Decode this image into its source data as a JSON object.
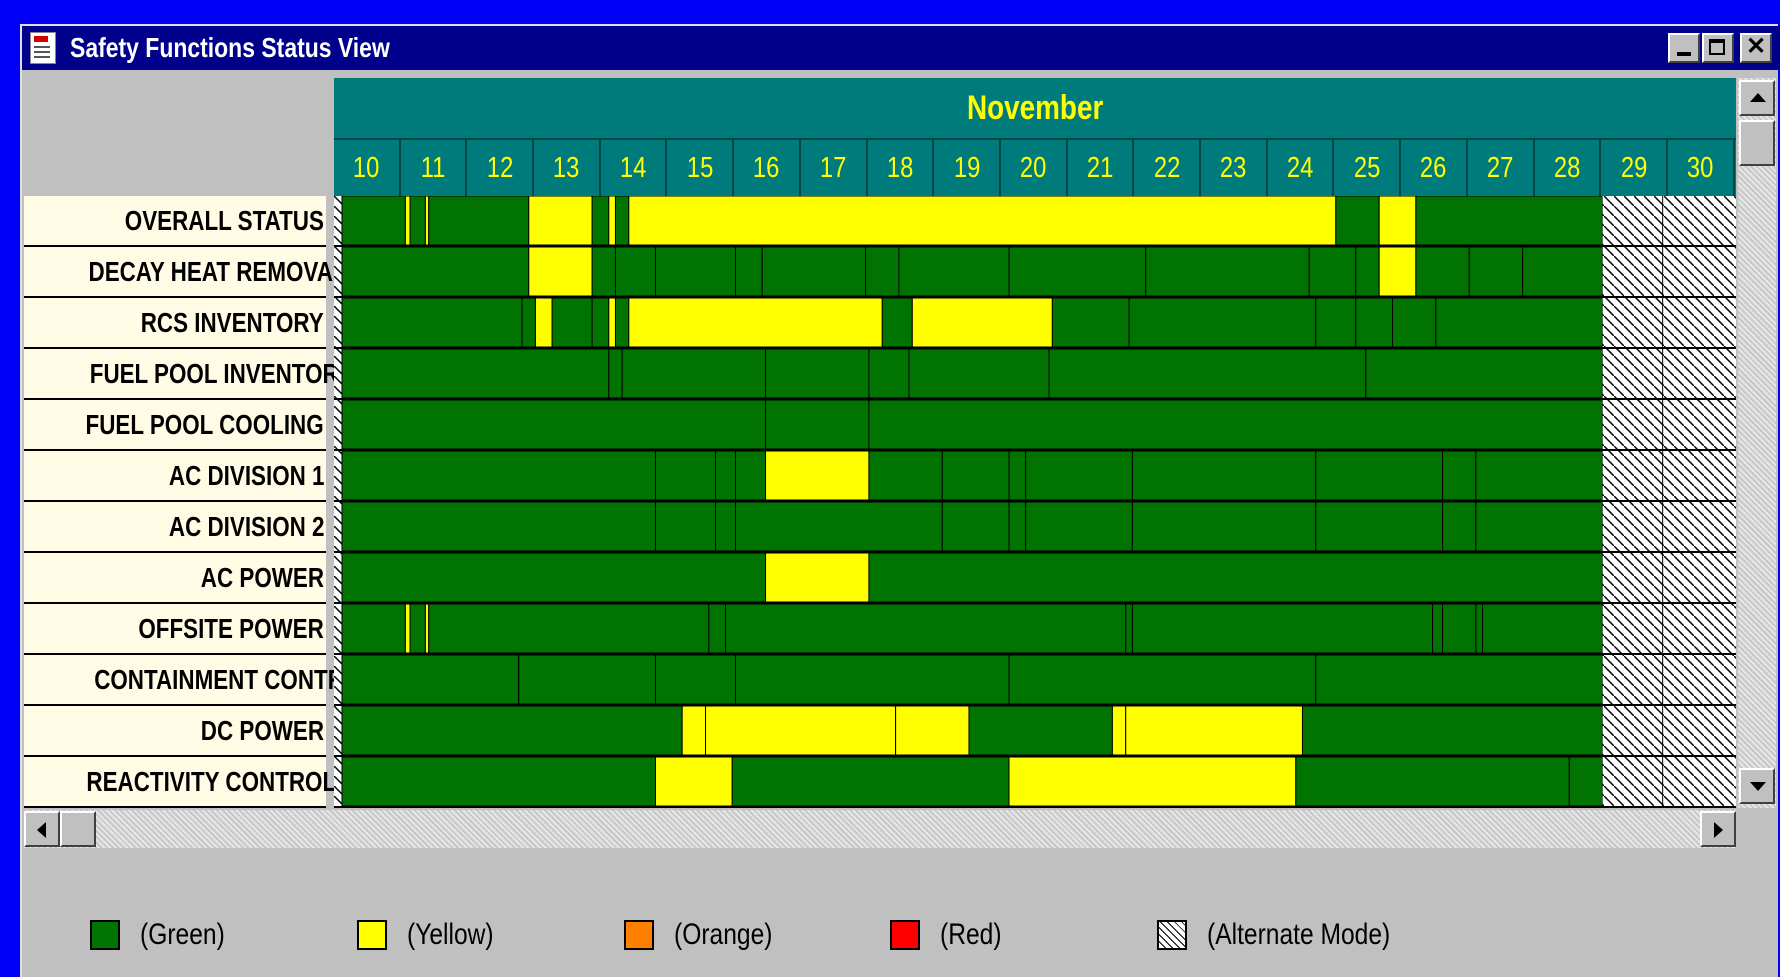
{
  "window": {
    "title": "Safety Functions Status View",
    "buttons": [
      "minimize",
      "maximize",
      "close"
    ]
  },
  "colors": {
    "desktop": "#0000f6",
    "titlebar": "#00008a",
    "header": "#007b7b",
    "header_text": "#ffff00",
    "green": "#007300",
    "yellow": "#ffff00",
    "orange": "#ff8000",
    "red": "#ff0000",
    "label_bg": "#fffbe5"
  },
  "timeline": {
    "month": "November",
    "days": [
      "10",
      "11",
      "12",
      "13",
      "14",
      "15",
      "16",
      "17",
      "18",
      "19",
      "20",
      "21",
      "22",
      "23",
      "24",
      "25",
      "26",
      "27",
      "28",
      "29",
      "30"
    ],
    "alternate_mode_from_day": 28.9,
    "day_range": [
      10,
      31
    ]
  },
  "rows": [
    {
      "label": "OVERALL STATUS",
      "segments": [
        {
          "s": 10.0,
          "e": 10.95,
          "c": "green"
        },
        {
          "s": 10.95,
          "e": 11.02,
          "c": "yellow"
        },
        {
          "s": 11.02,
          "e": 11.25,
          "c": "green"
        },
        {
          "s": 11.25,
          "e": 11.3,
          "c": "yellow"
        },
        {
          "s": 11.3,
          "e": 12.8,
          "c": "green"
        },
        {
          "s": 12.8,
          "e": 13.75,
          "c": "yellow"
        },
        {
          "s": 13.75,
          "e": 14.0,
          "c": "green"
        },
        {
          "s": 14.0,
          "e": 14.1,
          "c": "yellow"
        },
        {
          "s": 14.1,
          "e": 14.3,
          "c": "green"
        },
        {
          "s": 14.3,
          "e": 24.9,
          "c": "yellow"
        },
        {
          "s": 24.9,
          "e": 25.55,
          "c": "green"
        },
        {
          "s": 25.55,
          "e": 26.1,
          "c": "yellow"
        },
        {
          "s": 26.1,
          "e": 28.9,
          "c": "green"
        }
      ]
    },
    {
      "label": "DECAY HEAT REMOVAL",
      "segments": [
        {
          "s": 10.0,
          "e": 12.8,
          "c": "green"
        },
        {
          "s": 12.8,
          "e": 13.75,
          "c": "yellow"
        },
        {
          "s": 13.75,
          "e": 14.1,
          "c": "green"
        },
        {
          "s": 14.1,
          "e": 14.7,
          "c": "green"
        },
        {
          "s": 14.7,
          "e": 15.9,
          "c": "green"
        },
        {
          "s": 15.9,
          "e": 16.3,
          "c": "green"
        },
        {
          "s": 16.3,
          "e": 17.85,
          "c": "green"
        },
        {
          "s": 17.85,
          "e": 18.35,
          "c": "green"
        },
        {
          "s": 18.35,
          "e": 20.0,
          "c": "green"
        },
        {
          "s": 20.0,
          "e": 22.05,
          "c": "green"
        },
        {
          "s": 22.05,
          "e": 24.5,
          "c": "green"
        },
        {
          "s": 24.5,
          "e": 25.2,
          "c": "green"
        },
        {
          "s": 25.2,
          "e": 25.55,
          "c": "green"
        },
        {
          "s": 25.55,
          "e": 26.1,
          "c": "yellow"
        },
        {
          "s": 26.1,
          "e": 26.9,
          "c": "green"
        },
        {
          "s": 26.9,
          "e": 27.7,
          "c": "green"
        },
        {
          "s": 27.7,
          "e": 28.9,
          "c": "green"
        }
      ]
    },
    {
      "label": "RCS INVENTORY",
      "segments": [
        {
          "s": 10.0,
          "e": 12.7,
          "c": "green"
        },
        {
          "s": 12.7,
          "e": 12.9,
          "c": "green"
        },
        {
          "s": 12.9,
          "e": 13.15,
          "c": "yellow"
        },
        {
          "s": 13.15,
          "e": 13.75,
          "c": "green"
        },
        {
          "s": 13.75,
          "e": 14.0,
          "c": "green"
        },
        {
          "s": 14.0,
          "e": 14.1,
          "c": "yellow"
        },
        {
          "s": 14.1,
          "e": 14.3,
          "c": "green"
        },
        {
          "s": 14.3,
          "e": 18.1,
          "c": "yellow"
        },
        {
          "s": 18.1,
          "e": 18.55,
          "c": "green"
        },
        {
          "s": 18.55,
          "e": 20.65,
          "c": "yellow"
        },
        {
          "s": 20.65,
          "e": 21.8,
          "c": "green"
        },
        {
          "s": 21.8,
          "e": 24.6,
          "c": "green"
        },
        {
          "s": 24.6,
          "e": 25.2,
          "c": "green"
        },
        {
          "s": 25.2,
          "e": 25.75,
          "c": "green"
        },
        {
          "s": 25.75,
          "e": 26.4,
          "c": "green"
        },
        {
          "s": 26.4,
          "e": 28.9,
          "c": "green"
        }
      ]
    },
    {
      "label": "FUEL POOL INVENTORY",
      "segments": [
        {
          "s": 10.0,
          "e": 14.0,
          "c": "green"
        },
        {
          "s": 14.0,
          "e": 14.2,
          "c": "green"
        },
        {
          "s": 14.2,
          "e": 16.35,
          "c": "green"
        },
        {
          "s": 16.35,
          "e": 17.9,
          "c": "green"
        },
        {
          "s": 17.9,
          "e": 18.5,
          "c": "green"
        },
        {
          "s": 18.5,
          "e": 20.6,
          "c": "green"
        },
        {
          "s": 20.6,
          "e": 25.35,
          "c": "green"
        },
        {
          "s": 25.35,
          "e": 28.9,
          "c": "green"
        }
      ]
    },
    {
      "label": "FUEL POOL COOLING",
      "segments": [
        {
          "s": 10.0,
          "e": 16.35,
          "c": "green"
        },
        {
          "s": 16.35,
          "e": 17.9,
          "c": "green"
        },
        {
          "s": 17.9,
          "e": 28.9,
          "c": "green"
        }
      ]
    },
    {
      "label": "AC DIVISION 1",
      "segments": [
        {
          "s": 10.0,
          "e": 14.7,
          "c": "green"
        },
        {
          "s": 14.7,
          "e": 15.6,
          "c": "green"
        },
        {
          "s": 15.6,
          "e": 15.9,
          "c": "green"
        },
        {
          "s": 15.9,
          "e": 16.35,
          "c": "green"
        },
        {
          "s": 16.35,
          "e": 17.9,
          "c": "yellow"
        },
        {
          "s": 17.9,
          "e": 19.0,
          "c": "green"
        },
        {
          "s": 19.0,
          "e": 20.0,
          "c": "green"
        },
        {
          "s": 20.0,
          "e": 20.25,
          "c": "green"
        },
        {
          "s": 20.25,
          "e": 21.85,
          "c": "green"
        },
        {
          "s": 21.85,
          "e": 24.6,
          "c": "green"
        },
        {
          "s": 24.6,
          "e": 26.5,
          "c": "green"
        },
        {
          "s": 26.5,
          "e": 27.0,
          "c": "green"
        },
        {
          "s": 27.0,
          "e": 28.9,
          "c": "green"
        }
      ]
    },
    {
      "label": "AC DIVISION 2",
      "segments": [
        {
          "s": 10.0,
          "e": 14.7,
          "c": "green"
        },
        {
          "s": 14.7,
          "e": 15.6,
          "c": "green"
        },
        {
          "s": 15.6,
          "e": 15.9,
          "c": "green"
        },
        {
          "s": 15.9,
          "e": 19.0,
          "c": "green"
        },
        {
          "s": 19.0,
          "e": 20.0,
          "c": "green"
        },
        {
          "s": 20.0,
          "e": 20.25,
          "c": "green"
        },
        {
          "s": 20.25,
          "e": 21.85,
          "c": "green"
        },
        {
          "s": 21.85,
          "e": 24.6,
          "c": "green"
        },
        {
          "s": 24.6,
          "e": 26.5,
          "c": "green"
        },
        {
          "s": 26.5,
          "e": 27.0,
          "c": "green"
        },
        {
          "s": 27.0,
          "e": 28.9,
          "c": "green"
        }
      ]
    },
    {
      "label": "AC POWER",
      "segments": [
        {
          "s": 10.0,
          "e": 16.35,
          "c": "green"
        },
        {
          "s": 16.35,
          "e": 17.9,
          "c": "yellow"
        },
        {
          "s": 17.9,
          "e": 28.9,
          "c": "green"
        }
      ]
    },
    {
      "label": "OFFSITE POWER",
      "segments": [
        {
          "s": 10.0,
          "e": 10.95,
          "c": "green"
        },
        {
          "s": 10.95,
          "e": 11.02,
          "c": "yellow"
        },
        {
          "s": 11.02,
          "e": 11.25,
          "c": "green"
        },
        {
          "s": 11.25,
          "e": 11.3,
          "c": "yellow"
        },
        {
          "s": 11.3,
          "e": 15.5,
          "c": "green"
        },
        {
          "s": 15.5,
          "e": 15.75,
          "c": "green"
        },
        {
          "s": 15.75,
          "e": 21.75,
          "c": "green"
        },
        {
          "s": 21.75,
          "e": 21.85,
          "c": "green"
        },
        {
          "s": 21.85,
          "e": 26.35,
          "c": "green"
        },
        {
          "s": 26.35,
          "e": 26.5,
          "c": "green"
        },
        {
          "s": 26.5,
          "e": 27.0,
          "c": "green"
        },
        {
          "s": 27.0,
          "e": 27.1,
          "c": "green"
        },
        {
          "s": 27.1,
          "e": 28.9,
          "c": "green"
        }
      ]
    },
    {
      "label": "CONTAINMENT CONTROL",
      "segments": [
        {
          "s": 10.0,
          "e": 12.65,
          "c": "green"
        },
        {
          "s": 12.65,
          "e": 14.7,
          "c": "green"
        },
        {
          "s": 14.7,
          "e": 15.9,
          "c": "green"
        },
        {
          "s": 15.9,
          "e": 20.0,
          "c": "green"
        },
        {
          "s": 20.0,
          "e": 24.6,
          "c": "green"
        },
        {
          "s": 24.6,
          "e": 28.9,
          "c": "green"
        }
      ]
    },
    {
      "label": "DC POWER",
      "segments": [
        {
          "s": 10.0,
          "e": 15.1,
          "c": "green"
        },
        {
          "s": 15.1,
          "e": 15.45,
          "c": "yellow"
        },
        {
          "s": 15.45,
          "e": 18.3,
          "c": "yellow"
        },
        {
          "s": 18.3,
          "e": 19.4,
          "c": "yellow"
        },
        {
          "s": 19.4,
          "e": 21.55,
          "c": "green"
        },
        {
          "s": 21.55,
          "e": 21.75,
          "c": "yellow"
        },
        {
          "s": 21.75,
          "e": 24.4,
          "c": "yellow"
        },
        {
          "s": 24.4,
          "e": 28.9,
          "c": "green"
        }
      ]
    },
    {
      "label": "REACTIVITY CONTROL",
      "segments": [
        {
          "s": 10.0,
          "e": 14.7,
          "c": "green"
        },
        {
          "s": 14.7,
          "e": 15.85,
          "c": "yellow"
        },
        {
          "s": 15.85,
          "e": 20.0,
          "c": "green"
        },
        {
          "s": 20.0,
          "e": 24.3,
          "c": "yellow"
        },
        {
          "s": 24.3,
          "e": 28.4,
          "c": "green"
        },
        {
          "s": 28.4,
          "e": 28.9,
          "c": "green"
        }
      ]
    }
  ],
  "legend": [
    {
      "label": "(Green)",
      "color": "#007300",
      "key": "green"
    },
    {
      "label": "(Yellow)",
      "color": "#ffff00",
      "key": "yellow"
    },
    {
      "label": "(Orange)",
      "color": "#ff8000",
      "key": "orange"
    },
    {
      "label": "(Red)",
      "color": "#ff0000",
      "key": "red"
    },
    {
      "label": "(Alternate Mode)",
      "color": "#ffffff",
      "key": "alternate"
    }
  ]
}
